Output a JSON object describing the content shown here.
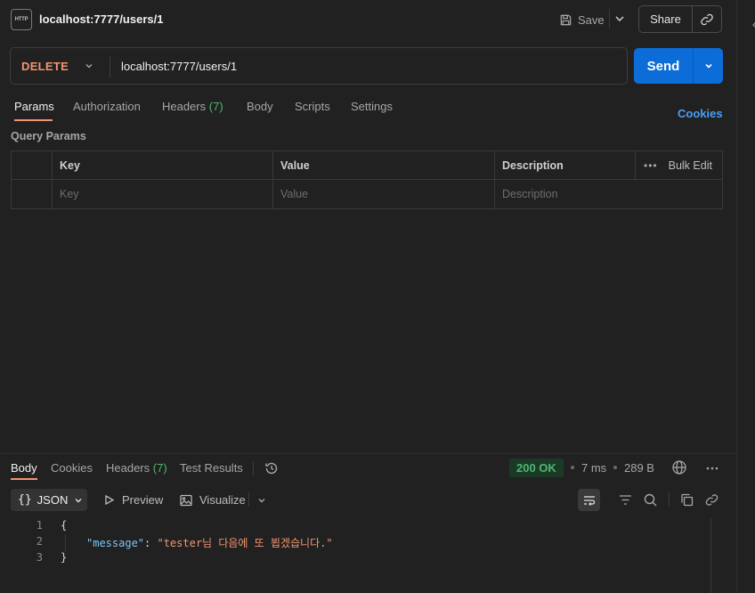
{
  "header": {
    "title": "localhost:7777/users/1",
    "save_label": "Save",
    "share_label": "Share"
  },
  "request": {
    "method": "DELETE",
    "url": "localhost:7777/users/1",
    "send_label": "Send"
  },
  "request_tabs": {
    "params": "Params",
    "authorization": "Authorization",
    "headers": "Headers",
    "headers_count": "(7)",
    "body": "Body",
    "scripts": "Scripts",
    "settings": "Settings",
    "cookies": "Cookies"
  },
  "query_params": {
    "title": "Query Params",
    "columns": [
      "Key",
      "Value",
      "Description"
    ],
    "bulk_edit": "Bulk Edit",
    "placeholders": [
      "Key",
      "Value",
      "Description"
    ]
  },
  "response_tabs": {
    "body": "Body",
    "cookies": "Cookies",
    "headers": "Headers",
    "headers_count": "(7)",
    "test_results": "Test Results"
  },
  "response_meta": {
    "status": "200 OK",
    "time": "7 ms",
    "size": "289 B"
  },
  "response_toolbar": {
    "format": "JSON",
    "preview": "Preview",
    "visualize": "Visualize"
  },
  "response_body": {
    "line_numbers": [
      "1",
      "2",
      "3"
    ],
    "open_brace": "{",
    "key": "\"message\"",
    "colon": ": ",
    "value": "\"tester님 다음에 또 뵙겠습니다.\"",
    "close_brace": "}"
  },
  "colors": {
    "method": "#f09570",
    "send_button": "#0c6dd9",
    "accent_underline": "#f09570",
    "status_ok": "#4fb673",
    "link": "#4a9ff5"
  }
}
